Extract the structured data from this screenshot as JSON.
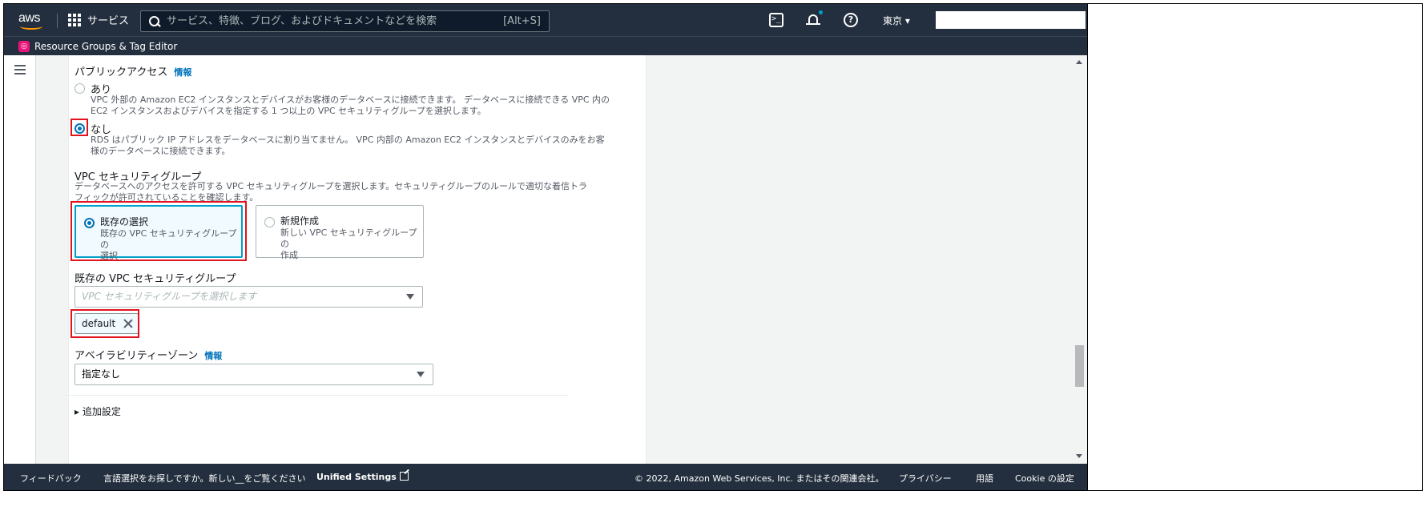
{
  "topnav": {
    "logo_text": "aws",
    "services_label": "サービス",
    "search_placeholder": "サービス、特徴、ブログ、およびドキュメントなどを検索",
    "search_shortcut": "[Alt+S]",
    "region_label": "東京 ▾"
  },
  "subbar": {
    "favorite_label": "Resource Groups & Tag Editor"
  },
  "form": {
    "public_access": {
      "label": "パブリックアクセス",
      "info": "情報",
      "option_yes": {
        "label": "あり",
        "description_line1": "VPC 外部の Amazon EC2 インスタンスとデバイスがお客様のデータベースに接続できます。 データベースに接続できる VPC 内の",
        "description_line2": "EC2 インスタンスおよびデバイスを指定する 1 つ以上の VPC セキュリティグループを選択します。",
        "selected": false
      },
      "option_no": {
        "label": "なし",
        "description_line1": "RDS はパブリック IP アドレスをデータベースに割り当てません。 VPC 内部の Amazon EC2 インスタンスとデバイスのみをお客",
        "description_line2": "様のデータベースに接続できます。",
        "selected": true
      }
    },
    "vpc_sg": {
      "label": "VPC セキュリティグループ",
      "description_line1": "データベースへのアクセスを許可する VPC セキュリティグループを選択します。セキュリティグループのルールで適切な着信トラ",
      "description_line2": "フィックが許可されていることを確認します。",
      "tile_existing": {
        "title": "既存の選択",
        "desc_line1": "既存の VPC セキュリティグループの",
        "desc_line2": "選択",
        "selected": true
      },
      "tile_new": {
        "title": "新規作成",
        "desc_line1": "新しい VPC セキュリティグループの",
        "desc_line2": "作成",
        "selected": false
      }
    },
    "existing_sg": {
      "label": "既存の VPC セキュリティグループ",
      "placeholder": "VPC セキュリティグループを選択します",
      "token": "default"
    },
    "az": {
      "label": "アベイラビリティーゾーン",
      "info": "情報",
      "value": "指定なし"
    },
    "additional_settings": "▸ 追加設定"
  },
  "footer": {
    "feedback": "フィードバック",
    "language_prompt": "言語選択をお探しですか。新しい__をご覧ください",
    "unified_settings": "Unified Settings",
    "copyright": "© 2022, Amazon Web Services, Inc. またはその関連会社。",
    "privacy": "プライバシー",
    "terms": "用語",
    "cookie": "Cookie の設定"
  },
  "colors": {
    "nav_bg": "#232f3e",
    "accent": "#0073bb",
    "highlight": "#e0141e",
    "tile_selected": "#00a1c9"
  }
}
